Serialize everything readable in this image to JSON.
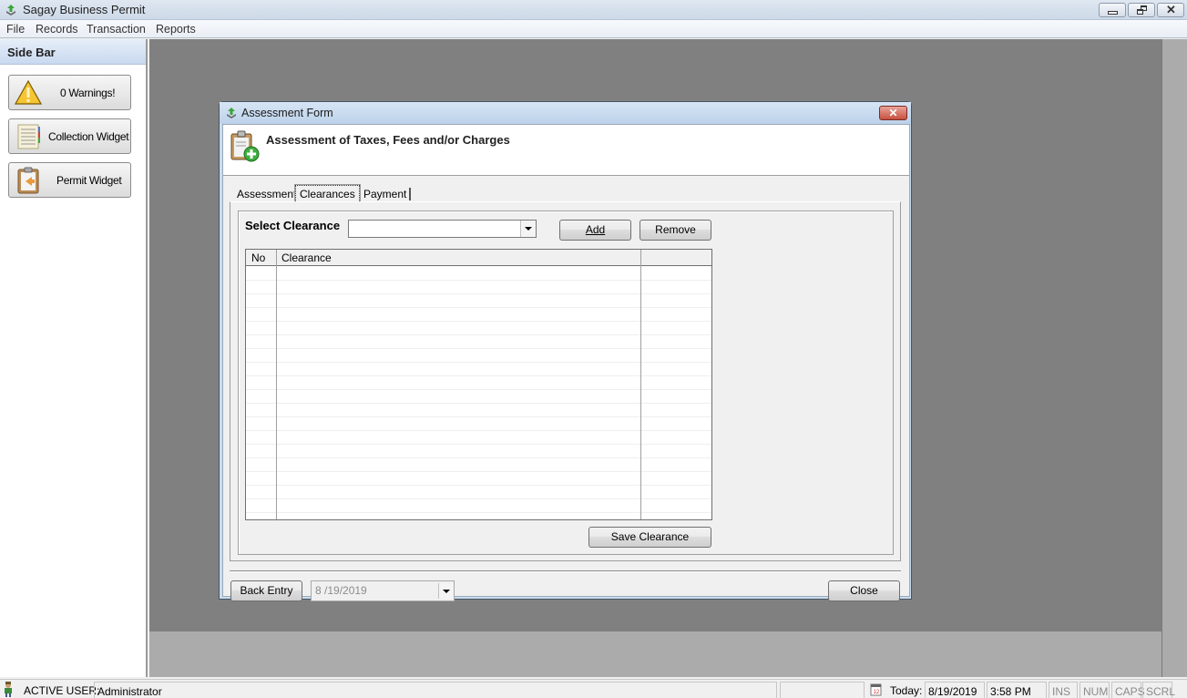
{
  "app": {
    "title": "Sagay Business Permit",
    "window_controls": [
      "minimize-icon",
      "restore-icon",
      "close-icon"
    ]
  },
  "menu": [
    "File",
    "Records",
    "Transaction",
    "Reports"
  ],
  "sidebar": {
    "title": "Side Bar",
    "buttons": [
      {
        "label": "0 Warnings!",
        "icon": "warning-icon"
      },
      {
        "label": "Collection Widget",
        "icon": "ledger-icon"
      },
      {
        "label": "Permit Widget",
        "icon": "clipboard-icon"
      }
    ]
  },
  "dialog": {
    "title": "Assessment Form",
    "close_label": "✕",
    "heading": "Assessment of Taxes, Fees and/or Charges",
    "tabs": [
      {
        "label": "Assessment",
        "active": false
      },
      {
        "label": "Clearances",
        "active": true
      },
      {
        "label": "Payment",
        "active": false
      }
    ],
    "clearances": {
      "select_label": "Select Clearance",
      "select_value": "",
      "add_label": "Add",
      "remove_label": "Remove",
      "table": {
        "columns": [
          "No",
          "Clearance",
          ""
        ],
        "rows": []
      },
      "save_label": "Save Clearance"
    },
    "footer": {
      "back_entry_label": "Back Entry",
      "date_value": "8 /19/2019",
      "close_label": "Close"
    }
  },
  "statusbar": {
    "active_user_label": "ACTIVE USER:",
    "active_user": "Administrator",
    "today_label": "Today:",
    "date": "8/19/2019",
    "time": "3:58 PM",
    "indicators": [
      "INS",
      "NUM",
      "CAPS",
      "SCRL"
    ]
  }
}
